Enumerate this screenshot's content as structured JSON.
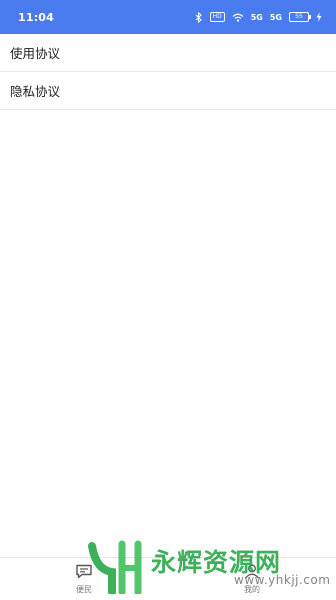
{
  "status_bar": {
    "time": "11:04",
    "hd_label": "HD",
    "signal1": "5G",
    "signal2": "5G",
    "battery": "55"
  },
  "menu": {
    "items": [
      {
        "label": "使用协议"
      },
      {
        "label": "隐私协议"
      }
    ]
  },
  "tabs": [
    {
      "label": "便民",
      "icon": "chat-icon"
    },
    {
      "label": "我的",
      "icon": "person-icon"
    }
  ],
  "watermark": {
    "text": "永辉资源网",
    "url": "www.yhkjj.com",
    "color": "#2aa84a"
  }
}
